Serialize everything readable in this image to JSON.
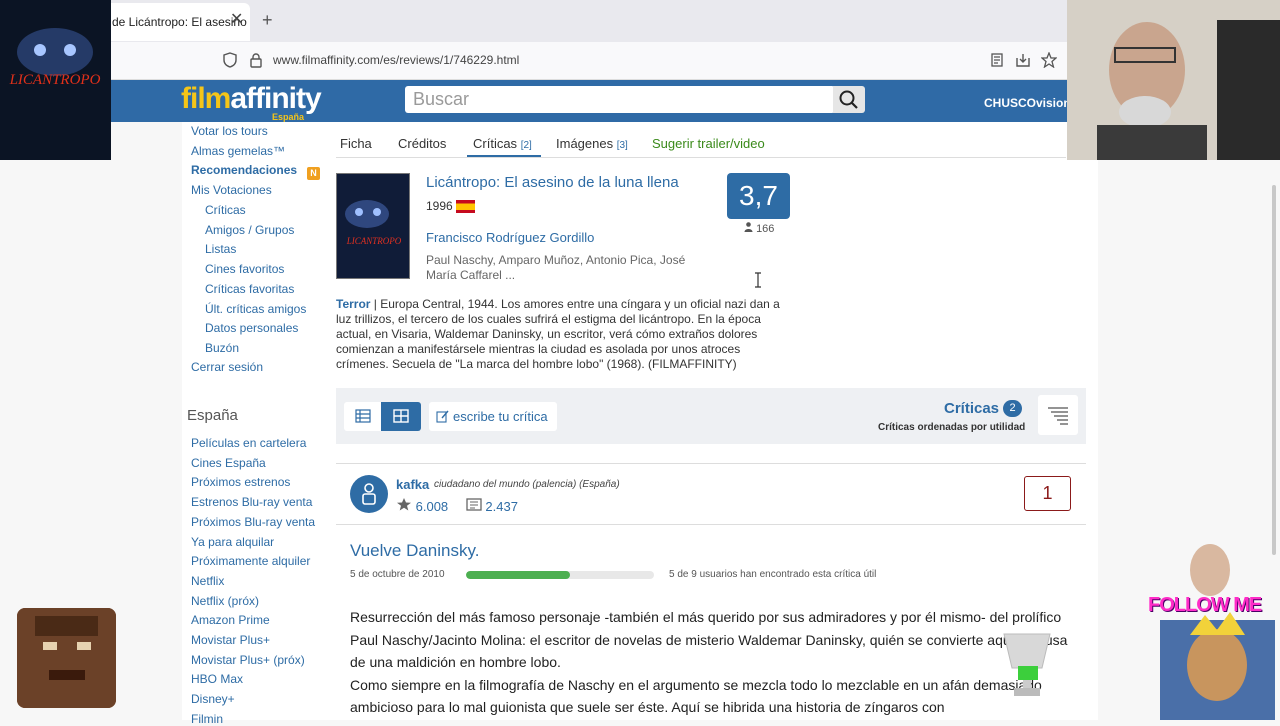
{
  "browser": {
    "tab_title": "de Licántropo: El asesino",
    "tab_close": "✕",
    "new_tab": "+",
    "url": "www.filmaffinity.com/es/reviews/1/746229.html"
  },
  "header": {
    "logo_film": "film",
    "logo_affinity": "affinity",
    "logo_sub": "España",
    "search_placeholder": "Buscar",
    "username": "CHUSCOvision"
  },
  "sidebar": {
    "top_items": [
      {
        "label": "Votar los tours"
      },
      {
        "label": "Almas gemelas™"
      },
      {
        "label": "Recomendaciones"
      },
      {
        "label": "Mis Votaciones"
      }
    ],
    "sub_items": [
      {
        "label": "Críticas"
      },
      {
        "label": "Amigos / Grupos"
      },
      {
        "label": "Listas"
      },
      {
        "label": "Cines favoritos"
      },
      {
        "label": "Críticas favoritas"
      },
      {
        "label": "Últ. críticas amigos"
      },
      {
        "label": "Datos personales"
      },
      {
        "label": "Buzón"
      }
    ],
    "logout": "Cerrar sesión",
    "badge_n": "N",
    "section_title": "España",
    "espana_items": [
      {
        "label": "Películas en cartelera"
      },
      {
        "label": "Cines España"
      },
      {
        "label": "Próximos estrenos"
      },
      {
        "label": "Estrenos Blu-ray venta"
      },
      {
        "label": "Próximos Blu-ray venta"
      },
      {
        "label": "Ya para alquilar"
      },
      {
        "label": "Próximamente alquiler"
      },
      {
        "label": "Netflix"
      },
      {
        "label": "Netflix (próx)"
      },
      {
        "label": "Amazon Prime"
      },
      {
        "label": "Movistar Plus+"
      },
      {
        "label": "Movistar Plus+ (próx)"
      },
      {
        "label": "HBO Max"
      },
      {
        "label": "Disney+"
      },
      {
        "label": "Filmin"
      }
    ]
  },
  "tabs": {
    "ficha": "Ficha",
    "creditos": "Créditos",
    "criticas": "Críticas",
    "criticas_count": "[2]",
    "imagenes": "Imágenes",
    "imagenes_count": "[3]",
    "trailer": "Sugerir trailer/video"
  },
  "movie": {
    "title": "Licántropo: El asesino de la luna llena",
    "year": "1996",
    "director": "Francisco Rodríguez Gordillo",
    "cast": "Paul Naschy, Amparo Muñoz, Antonio Pica, José María Caffarel ...",
    "rating": "3,7",
    "votes": "166",
    "genre": "Terror",
    "synopsis": " | Europa Central, 1944. Los amores entre una cíngara y un oficial nazi dan a luz trillizos, el tercero de los cuales sufrirá el estigma del licántropo. En la época actual, en Visaria, Waldemar Daninsky, un escritor, verá cómo extraños dolores comienzan a manifestársele mientras la ciudad es asolada por unos atroces crímenes. Secuela de \"La marca del hombre lobo\" (1968). (FILMAFFINITY)",
    "poster_text": "LICANTROPO"
  },
  "reviews_bar": {
    "write_label": "escribe tu crítica",
    "title": "Críticas",
    "count": "2",
    "order": "Críticas ordenadas por utilidad"
  },
  "review": {
    "user": "kafka",
    "meta": "ciudadano del mundo (palencia) (España)",
    "votes": "6.008",
    "reviews": "2.437",
    "score": "1",
    "title": "Vuelve Daninsky.",
    "date": "5 de octubre de 2010",
    "useful_fraction": 0.5556,
    "useful_text": "5 de 9 usuarios han encontrado esta crítica útil",
    "body_1": "Resurrección del más famoso personaje -también el más querido por sus admiradores y por él mismo- del prolífico Paul Naschy/Jacinto Molina: el escritor de novelas de misterio Waldemar Daninsky, quién se convierte aquí a causa de una maldición en hombre lobo.",
    "body_2": "Como siempre en la filmografía de Naschy en el argumento se mezcla todo lo mezclable en un afán demasiado ambicioso para lo mal guionista que suele ser éste. Aquí se hibrida una historia de zíngaros con"
  },
  "overlays": {
    "poster_label": "LICANTROPO",
    "follow": "FOLLOW ME"
  },
  "colors": {
    "brand_blue": "#2f6aa6",
    "link_blue": "#2e6ca5",
    "useful_green": "#4caf50",
    "score_red": "#8b1a1a"
  }
}
